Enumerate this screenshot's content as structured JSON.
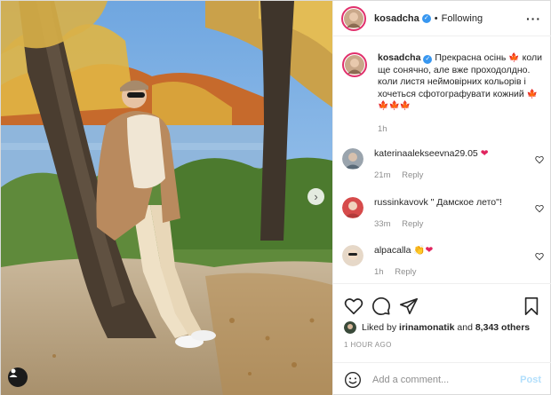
{
  "post": {
    "author": "kosadcha",
    "follow_status": "Following",
    "more_icon": "more-dots-icon",
    "caption_text": "Прекрасна осінь",
    "caption_text_2": "коли ще сонячно, але вже проходолдно. коли листя неймовірних кольорів і хочеться сфотографувати кожний",
    "caption_time": "1h",
    "likes_prefix": "Liked by",
    "likes_user": "irinamonatik",
    "likes_and": "and",
    "likes_count": "8,343 others",
    "time_ago": "1 HOUR AGO"
  },
  "comments": [
    {
      "username": "katerinaalekseevna29.05",
      "text": "",
      "time": "21m",
      "reply": "Reply",
      "emoji": "heart"
    },
    {
      "username": "russinkavovk",
      "text": "\" Дамское лето\"!",
      "time": "33m",
      "reply": "Reply",
      "emoji": ""
    },
    {
      "username": "alpacalla",
      "text": "",
      "time": "1h",
      "reply": "Reply",
      "emoji": "clap-heart"
    }
  ],
  "composer": {
    "placeholder": "Add a comment...",
    "post_label": "Post"
  },
  "colors": {
    "accent_blue": "#3897f0",
    "post_disabled": "#b2dffc",
    "story_ring": "#e1306c",
    "muted": "#8e8e8e"
  }
}
